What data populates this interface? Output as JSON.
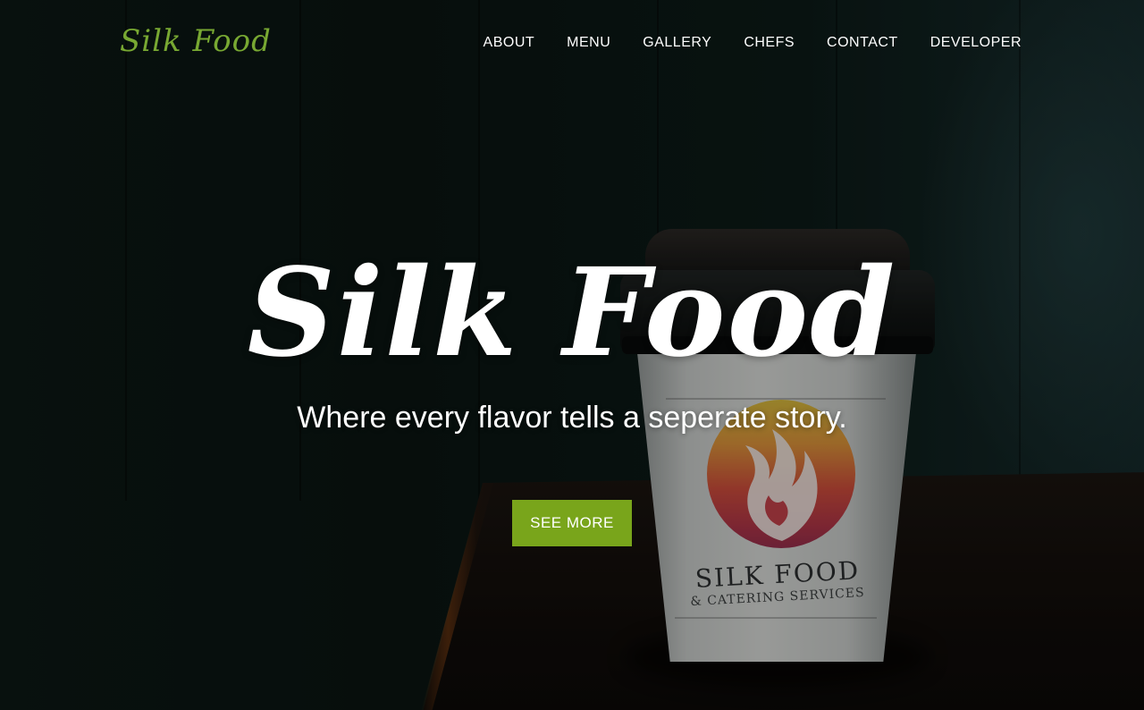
{
  "brand": {
    "name": "Silk Food",
    "color": "#78a832"
  },
  "nav": {
    "items": [
      {
        "label": "ABOUT"
      },
      {
        "label": "MENU"
      },
      {
        "label": "GALLERY"
      },
      {
        "label": "CHEFS"
      },
      {
        "label": "CONTACT"
      },
      {
        "label": "DEVELOPER"
      }
    ]
  },
  "hero": {
    "title": "Silk Food",
    "subtitle": "Where every flavor tells a seperate story.",
    "cta_label": "SEE MORE",
    "cta_color": "#79a51b"
  },
  "cup": {
    "brand": "SILK FOOD",
    "tagline": "& CATERING SERVICES"
  }
}
